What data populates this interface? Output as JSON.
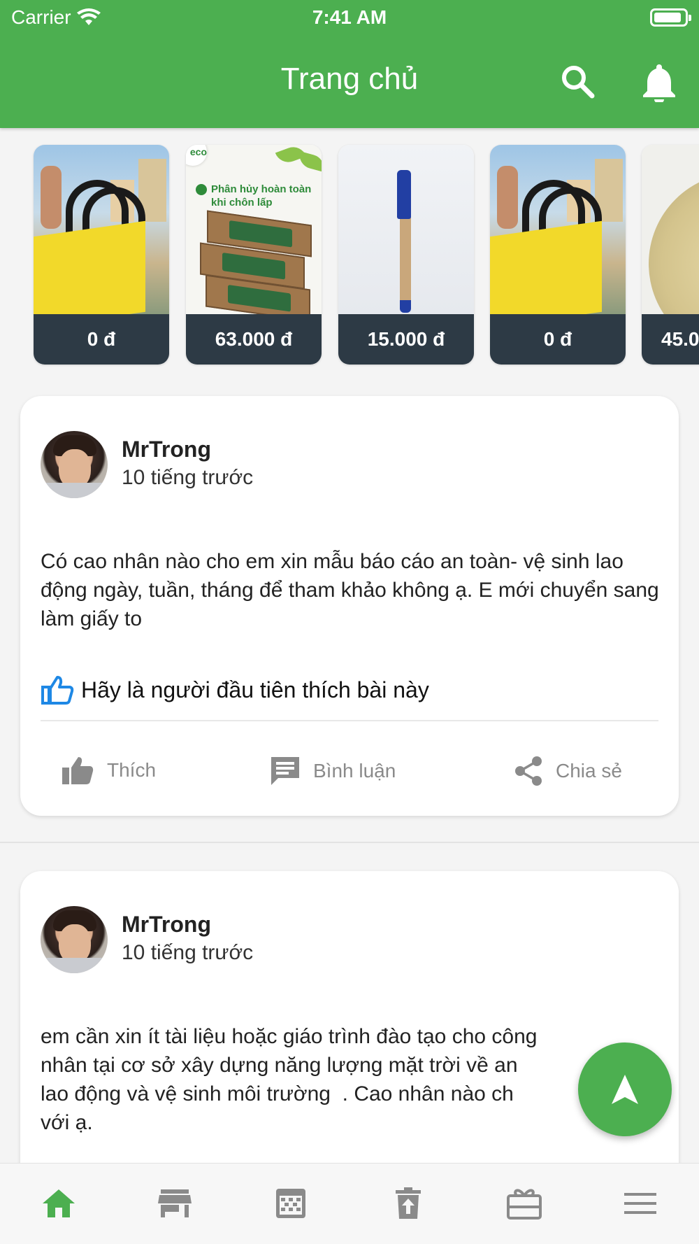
{
  "status_bar": {
    "carrier": "Carrier",
    "time": "7:41 AM"
  },
  "app_bar": {
    "title": "Trang chủ",
    "search_icon": "search-icon",
    "bell_icon": "bell-icon"
  },
  "products": [
    {
      "price": "0 đ",
      "image": "yellow-tote-bag"
    },
    {
      "price": "63.000 đ",
      "image": "eco-boxes",
      "caption": "Phân hủy hoàn toàn khi chôn lấp",
      "logo": "eco"
    },
    {
      "price": "15.000 đ",
      "image": "paper-pen"
    },
    {
      "price": "0 đ",
      "image": "yellow-tote-bag"
    },
    {
      "price": "45.0",
      "image": "round-lid"
    }
  ],
  "posts": [
    {
      "author": "MrTrong",
      "time": "10 tiếng trước",
      "text": "Có cao nhân nào cho em xin mẫu báo cáo an toàn- vệ sinh lao động ngày, tuần, tháng để tham khảo không ạ. E mới chuyển sang làm giấy to",
      "like_summary": "Hãy là người đầu tiên thích bài này",
      "actions": {
        "like": "Thích",
        "comment": "Bình luận",
        "share": "Chia sẻ"
      }
    },
    {
      "author": "MrTrong",
      "time": "10 tiếng trước",
      "text_lines": [
        "em cần xin ít tài liệu hoặc giáo trình đào tạo cho công",
        "nhân tại cơ sở xây dựng năng lượng mặt trời về an",
        "lao động và vệ sinh môi trường  . Cao nhân nào ch",
        "với ạ."
      ]
    }
  ],
  "fab": {
    "icon": "navigation-arrow-icon"
  },
  "bottom_nav": {
    "active": "home",
    "items": [
      "home-icon",
      "store-icon",
      "calendar-icon",
      "trash-upload-icon",
      "gift-card-icon",
      "menu-icon"
    ]
  },
  "colors": {
    "primary": "#4caf50",
    "price_bar": "#2d3a45",
    "action_gray": "#8a8a8a",
    "like_blue": "#1e88e5"
  }
}
